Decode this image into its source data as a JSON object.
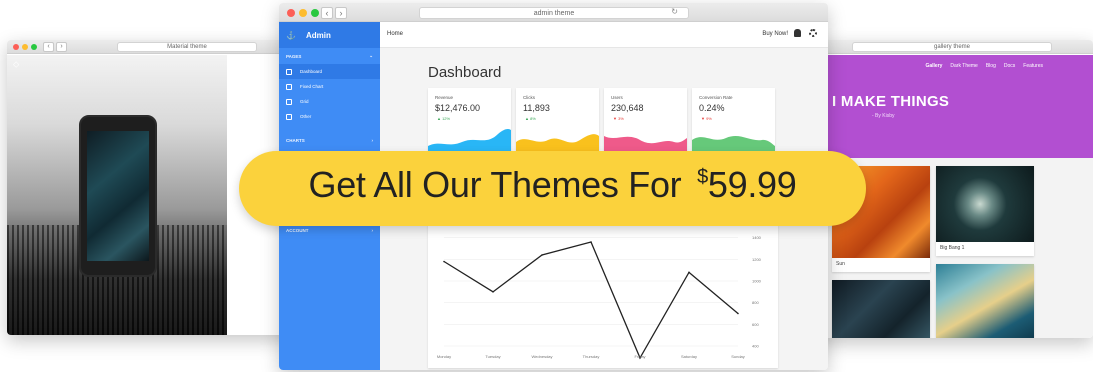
{
  "left_window": {
    "url": "Material theme",
    "logo_glyph": "⬦"
  },
  "right_window": {
    "url": "gallery theme",
    "nav": [
      "Gallery",
      "Dark Theme",
      "Blog",
      "Docs",
      "Features"
    ],
    "hero_title": "I MAKE THINGS",
    "hero_sub": "- By Kisby",
    "card_captions": [
      "Sun",
      "Big Bang 1"
    ],
    "colors": {
      "hero": "#b24fd1"
    }
  },
  "admin": {
    "url": "admin theme",
    "brand": "Admin",
    "sidebar": {
      "sections": [
        "PAGES",
        "CHARTS",
        "ACCOUNT"
      ],
      "items": [
        "Dashboard",
        "Fixed Chart",
        "Grid",
        "Other"
      ]
    },
    "topbar": {
      "home": "Home",
      "buy": "Buy Now!"
    },
    "page_title": "Dashboard",
    "stats": [
      {
        "label": "Revenue",
        "value": "$12,476.00",
        "change": "▲ 12%",
        "color": "#29b6f6",
        "dir": "up"
      },
      {
        "label": "Clicks",
        "value": "11,893",
        "change": "▲ 8%",
        "color": "#f9c11d",
        "dir": "up"
      },
      {
        "label": "Users",
        "value": "230,648",
        "change": "▼ 3%",
        "color": "#ef5a8a",
        "dir": "down"
      },
      {
        "label": "Conversion Rate",
        "value": "0.24%",
        "change": "▼ 9%",
        "color": "#66c97a",
        "dir": "down"
      }
    ]
  },
  "chart_data": {
    "type": "line",
    "categories": [
      "Monday",
      "Tuesday",
      "Wednesday",
      "Thursday",
      "Friday",
      "Saturday",
      "Sunday"
    ],
    "values": [
      1180,
      900,
      1240,
      1360,
      290,
      1080,
      700
    ],
    "y_ticks": [
      "1400",
      "1200",
      "1000",
      "800",
      "600",
      "400"
    ],
    "ylim": [
      400,
      1600
    ],
    "title": "",
    "xlabel": "",
    "ylabel": ""
  },
  "banner": {
    "text": "Get All Our Themes For",
    "currency": "$",
    "price": "59.99"
  }
}
